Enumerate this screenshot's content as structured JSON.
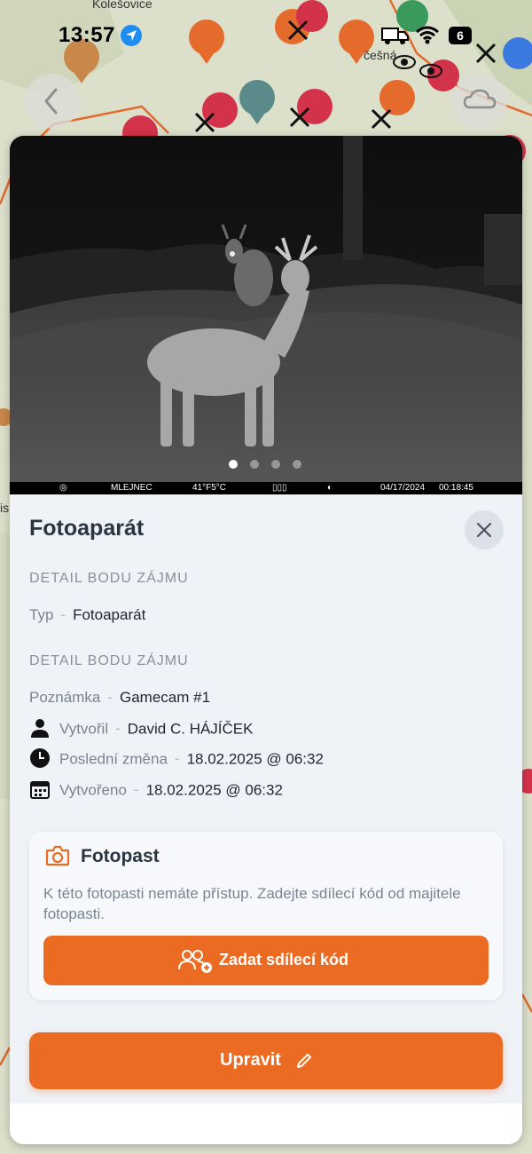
{
  "map": {
    "labels": [
      "Kolešovice",
      "češná",
      "is"
    ]
  },
  "status_bar": {
    "time": "13:57",
    "battery": "6",
    "icons": [
      "location-arrow-icon",
      "truck-icon",
      "wifi-icon",
      "battery-icon"
    ]
  },
  "controls": {
    "back_icon": "chevron-left-icon",
    "cloud_icon": "cloud-icon"
  },
  "photo": {
    "dots_count": 4,
    "active_dot": 0,
    "strip": {
      "location": "MLEJNEC",
      "temperature": "41°F5°C",
      "date": "04/17/2024",
      "time": "00:18:45"
    }
  },
  "detail": {
    "title": "Fotoaparát",
    "close_icon": "close-icon",
    "section1": {
      "heading": "DETAIL BODU ZÁJMU",
      "type_label": "Typ",
      "type_value": "Fotoaparát"
    },
    "section2": {
      "heading": "DETAIL BODU ZÁJMU",
      "note_label": "Poznámka",
      "note_value": "Gamecam #1",
      "creator_label": "Vytvořil",
      "creator_value": "David C. HÁJÍČEK",
      "modified_label": "Poslední změna",
      "modified_value": "18.02.2025 @ 06:32",
      "created_label": "Vytvořeno",
      "created_value": "18.02.2025 @ 06:32"
    },
    "separator": "-"
  },
  "trap_card": {
    "title": "Fotopast",
    "icon": "camera-icon",
    "message": "K této fotopasti nemáte přístup. Zadejte sdílecí kód od majitele fotopasti.",
    "button_label": "Zadat sdílecí kód",
    "button_icon": "add-users-icon"
  },
  "edit_button": {
    "label": "Upravit",
    "icon": "pencil-icon"
  },
  "colors": {
    "accent": "#ec6b22",
    "sheet_bg": "#eff2f7",
    "heading_gray": "#8a919c"
  }
}
